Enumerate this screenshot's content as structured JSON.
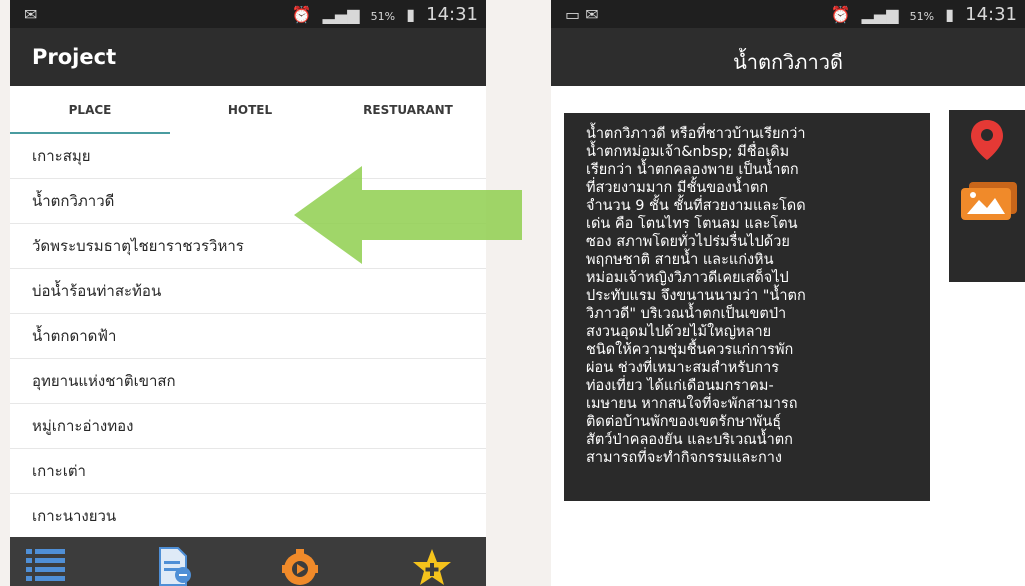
{
  "left_screen": {
    "status": {
      "battery": "51%",
      "time": "14:31"
    },
    "title": "Project",
    "tabs": [
      {
        "label": "PLACE",
        "active": true
      },
      {
        "label": "HOTEL",
        "active": false
      },
      {
        "label": "RESTUARANT",
        "active": false
      }
    ],
    "places": [
      "เกาะสมุย",
      "น้ำตกวิภาวดี",
      "วัดพระบรมธาตุไชยาราชวรวิหาร",
      "บ่อน้ำร้อนท่าสะท้อน",
      "น้ำตกดาดฟ้า",
      "อุทยานแห่งชาติเขาสก",
      "หมู่เกาะอ่างทอง",
      "เกาะเต่า",
      "เกาะนางยวน"
    ],
    "bottom_nav": [
      {
        "icon": "list-icon"
      },
      {
        "icon": "document-icon"
      },
      {
        "icon": "settings-play-icon"
      },
      {
        "icon": "star-add-icon"
      }
    ]
  },
  "right_screen": {
    "status": {
      "battery": "51%",
      "time": "14:31"
    },
    "title": "น้ำตกวิภาวดี",
    "description_lines": [
      "น้ำตกวิภาวดี หรือที่ชาวบ้านเรียกว่า",
      "น้ำตกหม่อมเจ้า&nbsp; มีชื่อเดิม",
      "เรียกว่า น้ำตกคลองพาย เป็นน้ำตก",
      "ที่สวยงามมาก มีชั้นของน้ำตก",
      "จำนวน 9 ชั้น ชั้นที่สวยงามและโดด",
      "เด่น คือ โตนไทร โตนลม และโตน",
      "ซอง สภาพโดยทั่วไปร่มรื่นไปด้วย",
      "พฤกษชาติ สายน้ำ และแก่งหิน",
      "หม่อมเจ้าหญิงวิภาวดีเคยเสด็จไป",
      "ประทับแรม จึงขนานนามว่า \"น้ำตก",
      "วิภาวดี\" บริเวณน้ำตกเป็นเขตป่า",
      "สงวนอุดมไปด้วยไม้ใหญ่หลาย",
      "ชนิดให้ความชุ่มชื้นควรแก่การพัก",
      "ผ่อน ช่วงที่เหมาะสมสำหรับการ",
      "ท่องเที่ยว ได้แก่เดือนมกราคม-",
      "เมษายน หากสนใจที่จะพักสามารถ",
      "ติดต่อบ้านพักของเขตรักษาพันธุ์",
      "สัตว์ป่าคลองยัน และบริเวณน้ำตก",
      "สามารถที่จะทำกิจกรรมและกาง"
    ],
    "side_actions": [
      {
        "icon": "map-pin-icon",
        "color": "#e53935"
      },
      {
        "icon": "gallery-icon",
        "color": "#f08a2a"
      }
    ]
  },
  "colors": {
    "arrow": "#8fcf4f",
    "tab_indicator": "#4a9ca0",
    "appbar": "#2d2d2d",
    "statusbar": "#1f1f1f"
  }
}
